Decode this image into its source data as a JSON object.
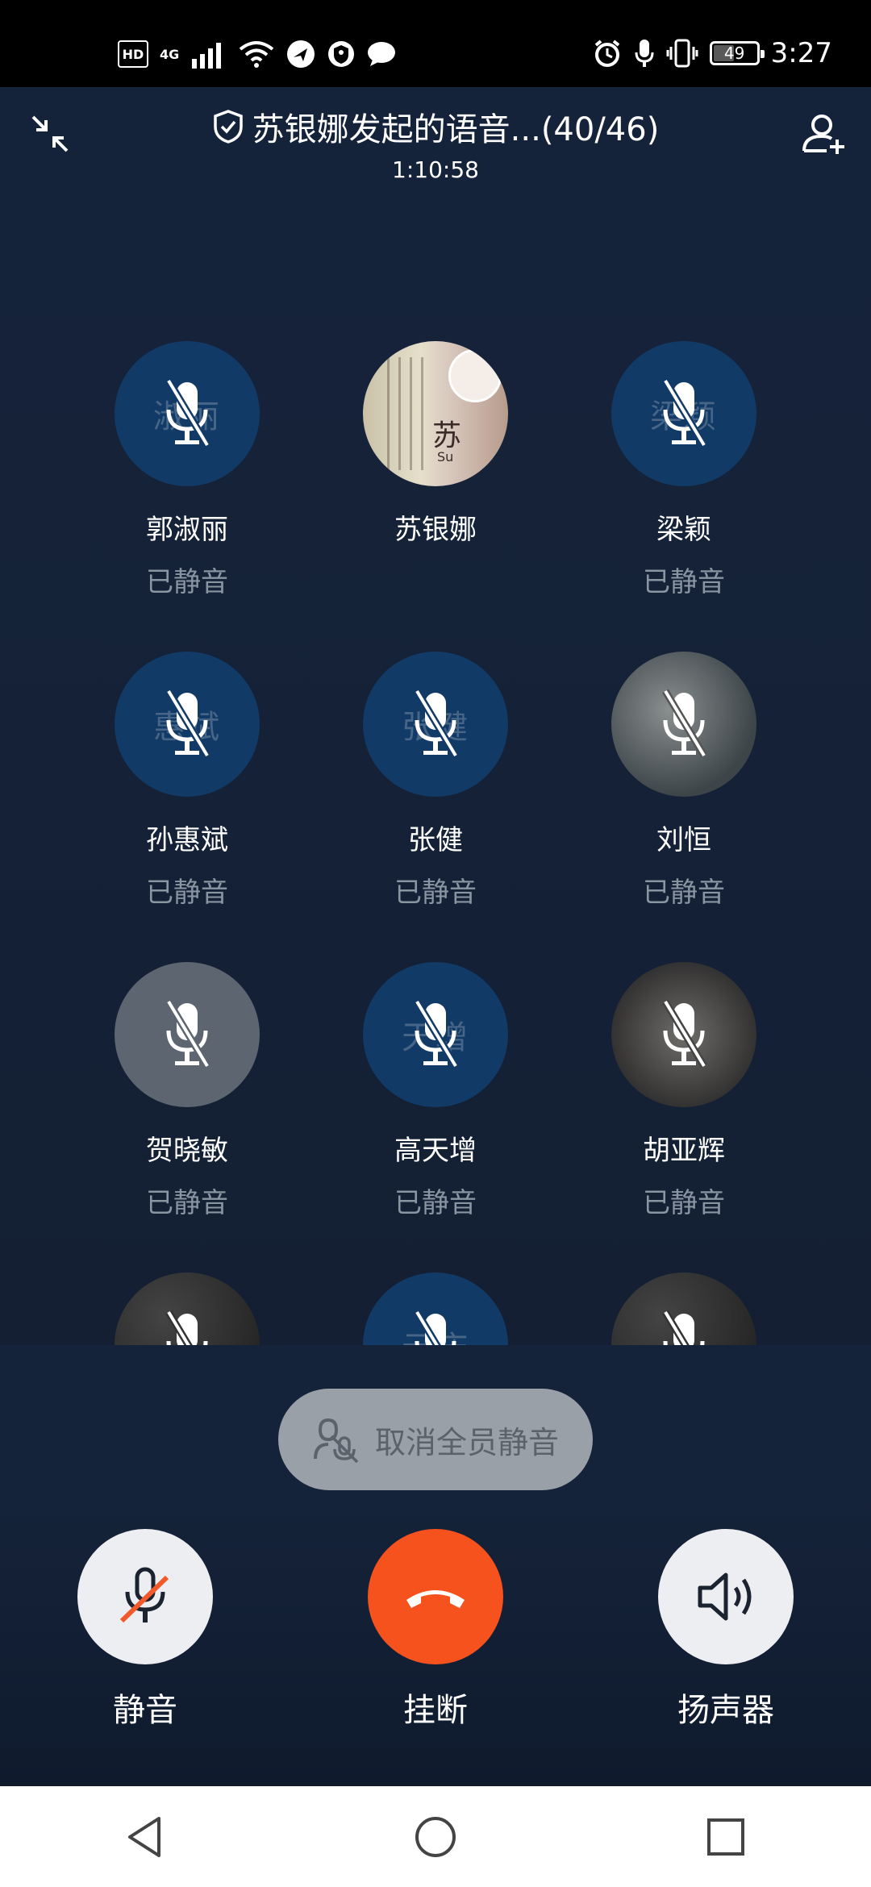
{
  "status_bar": {
    "left": {
      "hd": "HD",
      "network": "4G"
    },
    "right": {
      "battery": "49",
      "time": "3:27"
    }
  },
  "header": {
    "title": "苏银娜发起的语音...(40/46)",
    "timer": "1:10:58"
  },
  "participants": [
    {
      "name": "郭淑丽",
      "state": "已静音",
      "avatar_text": "淑丽",
      "avatar": "initials"
    },
    {
      "name": "苏银娜",
      "state": "",
      "avatar_text": "苏",
      "avatar_sub": "Su",
      "avatar": "art"
    },
    {
      "name": "梁颖",
      "state": "已静音",
      "avatar_text": "梁颖",
      "avatar": "initials"
    },
    {
      "name": "孙惠斌",
      "state": "已静音",
      "avatar_text": "惠斌",
      "avatar": "initials"
    },
    {
      "name": "张健",
      "state": "已静音",
      "avatar_text": "张健",
      "avatar": "initials"
    },
    {
      "name": "刘恒",
      "state": "已静音",
      "avatar_text": "",
      "avatar": "photo"
    },
    {
      "name": "贺晓敏",
      "state": "已静音",
      "avatar_text": "",
      "avatar": "grey"
    },
    {
      "name": "高天增",
      "state": "已静音",
      "avatar_text": "天增",
      "avatar": "initials"
    },
    {
      "name": "胡亚辉",
      "state": "已静音",
      "avatar_text": "",
      "avatar": "photo"
    },
    {
      "name": "",
      "state": "",
      "avatar_text": "",
      "avatar": "photo"
    },
    {
      "name": "",
      "state": "",
      "avatar_text": "元庆",
      "avatar": "initials"
    },
    {
      "name": "",
      "state": "",
      "avatar_text": "",
      "avatar": "photo"
    }
  ],
  "unmute_all": {
    "label": "取消全员静音"
  },
  "controls": {
    "mute_label": "静音",
    "hangup_label": "挂断",
    "speaker_label": "扬声器"
  },
  "colors": {
    "background": "#15233a",
    "avatar_blue": "#123a66",
    "hangup": "#f5521e",
    "muted_text": "#8a95a2"
  },
  "icons": {
    "minimize": "collapse-arrows-icon",
    "shield": "shield-check-icon",
    "add_person": "add-person-icon",
    "mic_off": "mic-off-icon",
    "unmute_all": "mic-person-icon",
    "hangup": "phone-hangup-icon",
    "speaker": "speaker-icon",
    "nav_back": "triangle-back-icon",
    "nav_home": "circle-home-icon",
    "nav_recent": "square-recent-icon"
  }
}
